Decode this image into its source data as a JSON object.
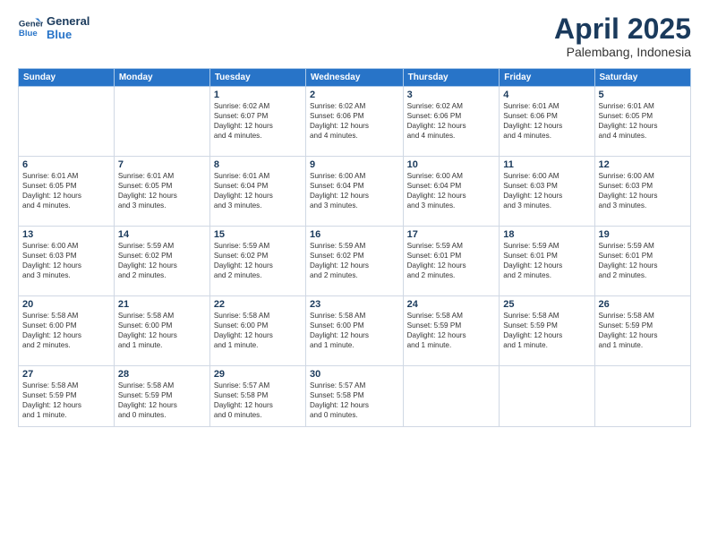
{
  "logo": {
    "line1": "General",
    "line2": "Blue"
  },
  "title": "April 2025",
  "subtitle": "Palembang, Indonesia",
  "days_header": [
    "Sunday",
    "Monday",
    "Tuesday",
    "Wednesday",
    "Thursday",
    "Friday",
    "Saturday"
  ],
  "weeks": [
    [
      {
        "num": "",
        "info": ""
      },
      {
        "num": "",
        "info": ""
      },
      {
        "num": "1",
        "info": "Sunrise: 6:02 AM\nSunset: 6:07 PM\nDaylight: 12 hours\nand 4 minutes."
      },
      {
        "num": "2",
        "info": "Sunrise: 6:02 AM\nSunset: 6:06 PM\nDaylight: 12 hours\nand 4 minutes."
      },
      {
        "num": "3",
        "info": "Sunrise: 6:02 AM\nSunset: 6:06 PM\nDaylight: 12 hours\nand 4 minutes."
      },
      {
        "num": "4",
        "info": "Sunrise: 6:01 AM\nSunset: 6:06 PM\nDaylight: 12 hours\nand 4 minutes."
      },
      {
        "num": "5",
        "info": "Sunrise: 6:01 AM\nSunset: 6:05 PM\nDaylight: 12 hours\nand 4 minutes."
      }
    ],
    [
      {
        "num": "6",
        "info": "Sunrise: 6:01 AM\nSunset: 6:05 PM\nDaylight: 12 hours\nand 4 minutes."
      },
      {
        "num": "7",
        "info": "Sunrise: 6:01 AM\nSunset: 6:05 PM\nDaylight: 12 hours\nand 3 minutes."
      },
      {
        "num": "8",
        "info": "Sunrise: 6:01 AM\nSunset: 6:04 PM\nDaylight: 12 hours\nand 3 minutes."
      },
      {
        "num": "9",
        "info": "Sunrise: 6:00 AM\nSunset: 6:04 PM\nDaylight: 12 hours\nand 3 minutes."
      },
      {
        "num": "10",
        "info": "Sunrise: 6:00 AM\nSunset: 6:04 PM\nDaylight: 12 hours\nand 3 minutes."
      },
      {
        "num": "11",
        "info": "Sunrise: 6:00 AM\nSunset: 6:03 PM\nDaylight: 12 hours\nand 3 minutes."
      },
      {
        "num": "12",
        "info": "Sunrise: 6:00 AM\nSunset: 6:03 PM\nDaylight: 12 hours\nand 3 minutes."
      }
    ],
    [
      {
        "num": "13",
        "info": "Sunrise: 6:00 AM\nSunset: 6:03 PM\nDaylight: 12 hours\nand 3 minutes."
      },
      {
        "num": "14",
        "info": "Sunrise: 5:59 AM\nSunset: 6:02 PM\nDaylight: 12 hours\nand 2 minutes."
      },
      {
        "num": "15",
        "info": "Sunrise: 5:59 AM\nSunset: 6:02 PM\nDaylight: 12 hours\nand 2 minutes."
      },
      {
        "num": "16",
        "info": "Sunrise: 5:59 AM\nSunset: 6:02 PM\nDaylight: 12 hours\nand 2 minutes."
      },
      {
        "num": "17",
        "info": "Sunrise: 5:59 AM\nSunset: 6:01 PM\nDaylight: 12 hours\nand 2 minutes."
      },
      {
        "num": "18",
        "info": "Sunrise: 5:59 AM\nSunset: 6:01 PM\nDaylight: 12 hours\nand 2 minutes."
      },
      {
        "num": "19",
        "info": "Sunrise: 5:59 AM\nSunset: 6:01 PM\nDaylight: 12 hours\nand 2 minutes."
      }
    ],
    [
      {
        "num": "20",
        "info": "Sunrise: 5:58 AM\nSunset: 6:00 PM\nDaylight: 12 hours\nand 2 minutes."
      },
      {
        "num": "21",
        "info": "Sunrise: 5:58 AM\nSunset: 6:00 PM\nDaylight: 12 hours\nand 1 minute."
      },
      {
        "num": "22",
        "info": "Sunrise: 5:58 AM\nSunset: 6:00 PM\nDaylight: 12 hours\nand 1 minute."
      },
      {
        "num": "23",
        "info": "Sunrise: 5:58 AM\nSunset: 6:00 PM\nDaylight: 12 hours\nand 1 minute."
      },
      {
        "num": "24",
        "info": "Sunrise: 5:58 AM\nSunset: 5:59 PM\nDaylight: 12 hours\nand 1 minute."
      },
      {
        "num": "25",
        "info": "Sunrise: 5:58 AM\nSunset: 5:59 PM\nDaylight: 12 hours\nand 1 minute."
      },
      {
        "num": "26",
        "info": "Sunrise: 5:58 AM\nSunset: 5:59 PM\nDaylight: 12 hours\nand 1 minute."
      }
    ],
    [
      {
        "num": "27",
        "info": "Sunrise: 5:58 AM\nSunset: 5:59 PM\nDaylight: 12 hours\nand 1 minute."
      },
      {
        "num": "28",
        "info": "Sunrise: 5:58 AM\nSunset: 5:59 PM\nDaylight: 12 hours\nand 0 minutes."
      },
      {
        "num": "29",
        "info": "Sunrise: 5:57 AM\nSunset: 5:58 PM\nDaylight: 12 hours\nand 0 minutes."
      },
      {
        "num": "30",
        "info": "Sunrise: 5:57 AM\nSunset: 5:58 PM\nDaylight: 12 hours\nand 0 minutes."
      },
      {
        "num": "",
        "info": ""
      },
      {
        "num": "",
        "info": ""
      },
      {
        "num": "",
        "info": ""
      }
    ]
  ]
}
